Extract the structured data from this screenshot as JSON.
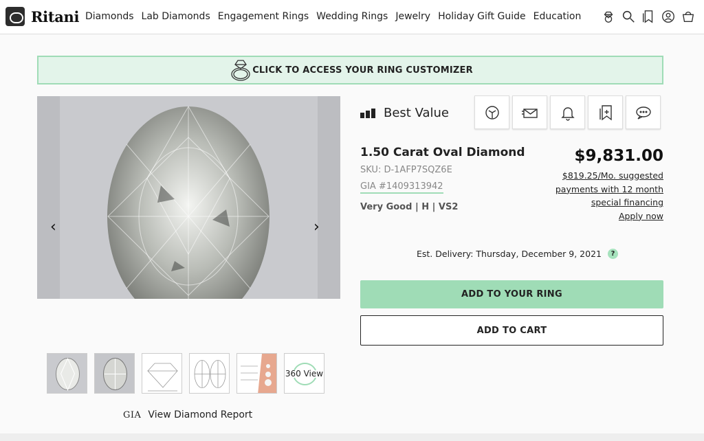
{
  "brand": {
    "name": "Ritani"
  },
  "nav": {
    "items": [
      "Diamonds",
      "Lab Diamonds",
      "Engagement Rings",
      "Wedding Rings",
      "Jewelry",
      "Holiday Gift Guide",
      "Education"
    ]
  },
  "banner": {
    "text": "CLICK TO ACCESS YOUR RING CUSTOMIZER"
  },
  "gallery": {
    "prev": "‹",
    "next": "›"
  },
  "thumbnails": {
    "view360_label": "360 View"
  },
  "report": {
    "gia_mark": "GIA",
    "label": "View Diamond Report"
  },
  "product": {
    "value_badge": "Best Value",
    "title": "1.50 Carat Oval Diamond",
    "sku": "SKU: D-1AFP7SQZ6E",
    "gia": "GIA #1409313942",
    "grades": "Very Good | H | VS2",
    "price": "$9,831.00",
    "financing_line1": "$819.25/Mo. suggested",
    "financing_line2": "payments with 12 month",
    "financing_line3": "special financing",
    "financing_apply": "Apply now",
    "delivery": "Est. Delivery: Thursday, December 9, 2021",
    "delivery_help": "?"
  },
  "buttons": {
    "add_ring": "ADD TO YOUR RING",
    "add_cart": "ADD TO CART"
  },
  "colors": {
    "accent": "#9fdcb6",
    "banner_bg": "#e3f4ea"
  }
}
